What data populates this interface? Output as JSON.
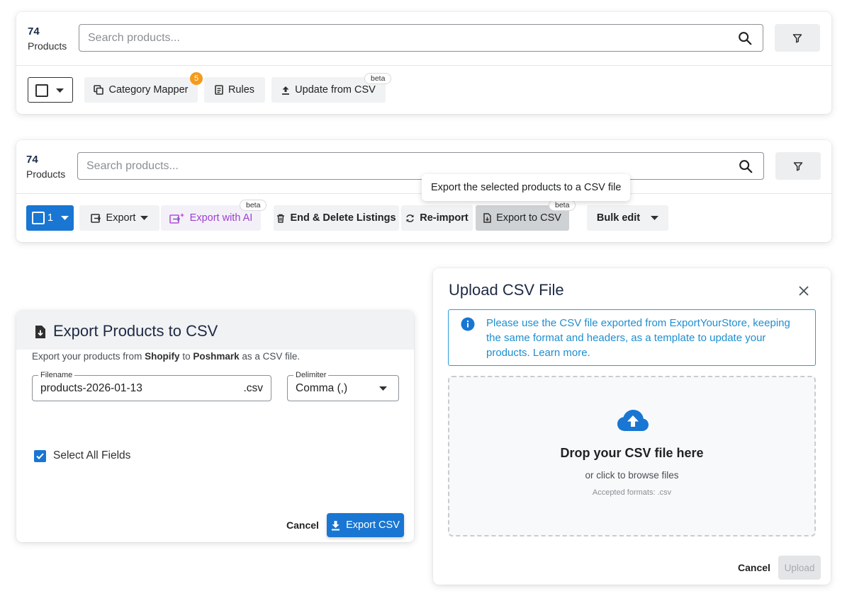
{
  "panel1": {
    "count_number": "74",
    "count_label": "Products",
    "search_placeholder": "Search products...",
    "category_mapper": "Category Mapper",
    "category_mapper_badge": "5",
    "rules": "Rules",
    "update_from_csv": "Update from CSV",
    "beta": "beta"
  },
  "panel2": {
    "count_number": "74",
    "count_label": "Products",
    "search_placeholder": "Search products...",
    "selected_count": "1",
    "export": "Export",
    "export_ai": "Export with AI",
    "end_delete": "End & Delete Listings",
    "reimport": "Re-import",
    "export_csv": "Export to CSV",
    "bulk_edit": "Bulk edit",
    "beta": "beta",
    "tooltip": "Export the selected products to a CSV file"
  },
  "export_dialog": {
    "title": "Export Products to CSV",
    "desc_prefix": "Export your products from ",
    "source": "Shopify",
    "desc_mid": " to ",
    "target": "Poshmark",
    "desc_suffix": " as a CSV file.",
    "filename_label": "Filename",
    "filename_value": "products-2026-01-13",
    "filename_suffix": ".csv",
    "delimiter_label": "Delimiter",
    "delimiter_value": "Comma (,)",
    "select_all": "Select All Fields",
    "cancel": "Cancel",
    "export_button": "Export CSV"
  },
  "upload_dialog": {
    "title": "Upload CSV File",
    "info": "Please use the CSV file exported from ExportYourStore, keeping the same format and headers, as a template to update your products. Learn more.",
    "drop_title": "Drop your CSV file here",
    "drop_sub": "or click to browse files",
    "accepted": "Accepted formats: .csv",
    "cancel": "Cancel",
    "upload": "Upload"
  },
  "colors": {
    "primary": "#1976d2",
    "info": "#1e8ed0",
    "badge": "#f49b1c",
    "ai": "#9c3fd0"
  },
  "icons": [
    "search-icon",
    "filter-icon",
    "category-mapper-icon",
    "rules-icon",
    "upload-icon",
    "export-icon",
    "ai-export-icon",
    "trash-icon",
    "refresh-icon",
    "csv-file-icon",
    "close-icon",
    "info-icon",
    "cloud-upload-icon",
    "download-icon",
    "checkmark-icon",
    "chevron-down-icon"
  ]
}
